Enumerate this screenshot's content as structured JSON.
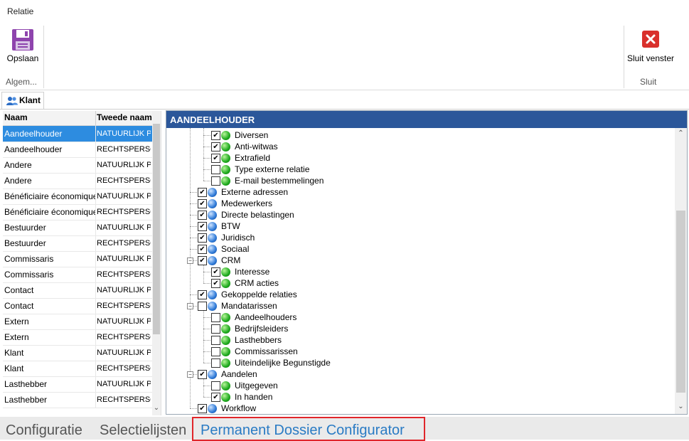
{
  "ribbon": {
    "title": "Relatie",
    "save_label": "Opslaan",
    "group_algemeen": "Algem...",
    "close_label": "Sluit venster",
    "group_sluit": "Sluit",
    "save_icon": "floppy-disk-icon",
    "close_icon": "red-close-icon"
  },
  "tabs": {
    "klant": "Klant",
    "klant_icon": "users-icon"
  },
  "list": {
    "columns": [
      "Naam",
      "Tweede naam"
    ],
    "rows": [
      [
        "Aandeelhouder",
        "NATUURLIJK P"
      ],
      [
        "Aandeelhouder",
        "RECHTSPERSO"
      ],
      [
        "Andere",
        "NATUURLIJK P"
      ],
      [
        "Andere",
        "RECHTSPERSO"
      ],
      [
        "Bénéficiaire économique",
        "NATUURLIJK P"
      ],
      [
        "Bénéficiaire économique",
        "RECHTSPERSO"
      ],
      [
        "Bestuurder",
        "NATUURLIJK P"
      ],
      [
        "Bestuurder",
        "RECHTSPERSO"
      ],
      [
        "Commissaris",
        "NATUURLIJK P"
      ],
      [
        "Commissaris",
        "RECHTSPERSO"
      ],
      [
        "Contact",
        "NATUURLIJK P"
      ],
      [
        "Contact",
        "RECHTSPERSO"
      ],
      [
        "Extern",
        "NATUURLIJK P"
      ],
      [
        "Extern",
        "RECHTSPERSO"
      ],
      [
        "Klant",
        "NATUURLIJK P"
      ],
      [
        "Klant",
        "RECHTSPERSO"
      ],
      [
        "Lasthebber",
        "NATUURLIJK P"
      ],
      [
        "Lasthebber",
        "RECHTSPERSO"
      ]
    ],
    "selected_index": 0
  },
  "panel": {
    "title": "AANDEELHOUDER",
    "tree": [
      {
        "label": "Diversen",
        "checked": true,
        "level": 2,
        "color": "green"
      },
      {
        "label": "Anti-witwas",
        "checked": true,
        "level": 2,
        "color": "green"
      },
      {
        "label": "Extrafield",
        "checked": true,
        "level": 2,
        "color": "green"
      },
      {
        "label": "Type externe relatie",
        "checked": false,
        "level": 2,
        "color": "green"
      },
      {
        "label": "E-mail bestemmelingen",
        "checked": false,
        "level": 2,
        "color": "green"
      },
      {
        "label": "Externe adressen",
        "checked": true,
        "level": 1,
        "color": "blue"
      },
      {
        "label": "Medewerkers",
        "checked": true,
        "level": 1,
        "color": "blue"
      },
      {
        "label": "Directe belastingen",
        "checked": true,
        "level": 1,
        "color": "blue"
      },
      {
        "label": "BTW",
        "checked": true,
        "level": 1,
        "color": "blue"
      },
      {
        "label": "Juridisch",
        "checked": true,
        "level": 1,
        "color": "blue"
      },
      {
        "label": "Sociaal",
        "checked": true,
        "level": 1,
        "color": "blue"
      },
      {
        "label": "CRM",
        "checked": true,
        "level": 1,
        "color": "blue",
        "expandable": true
      },
      {
        "label": "Interesse",
        "checked": true,
        "level": 2,
        "color": "green"
      },
      {
        "label": "CRM acties",
        "checked": true,
        "level": 2,
        "color": "green"
      },
      {
        "label": "Gekoppelde relaties",
        "checked": true,
        "level": 1,
        "color": "blue"
      },
      {
        "label": "Mandatarissen",
        "checked": false,
        "level": 1,
        "color": "blue",
        "expandable": true
      },
      {
        "label": "Aandeelhouders",
        "checked": false,
        "level": 2,
        "color": "green"
      },
      {
        "label": "Bedrijfsleiders",
        "checked": false,
        "level": 2,
        "color": "green"
      },
      {
        "label": "Lasthebbers",
        "checked": false,
        "level": 2,
        "color": "green"
      },
      {
        "label": "Commissarissen",
        "checked": false,
        "level": 2,
        "color": "green"
      },
      {
        "label": "Uiteindelijke Begunstigde",
        "checked": false,
        "level": 2,
        "color": "green"
      },
      {
        "label": "Aandelen",
        "checked": true,
        "level": 1,
        "color": "blue",
        "expandable": true
      },
      {
        "label": "Uitgegeven",
        "checked": false,
        "level": 2,
        "color": "green"
      },
      {
        "label": "In handen",
        "checked": true,
        "level": 2,
        "color": "green"
      },
      {
        "label": "Workflow",
        "checked": true,
        "level": 1,
        "color": "blue"
      }
    ]
  },
  "bottom_tabs": [
    "Configuratie",
    "Selectielijsten",
    "Permanent Dossier Configurator"
  ],
  "colors": {
    "header_blue": "#2b579a",
    "selected_row": "#2d8ce0",
    "active_tab_text": "#2a7bc4",
    "highlight_border": "#e0262b"
  }
}
